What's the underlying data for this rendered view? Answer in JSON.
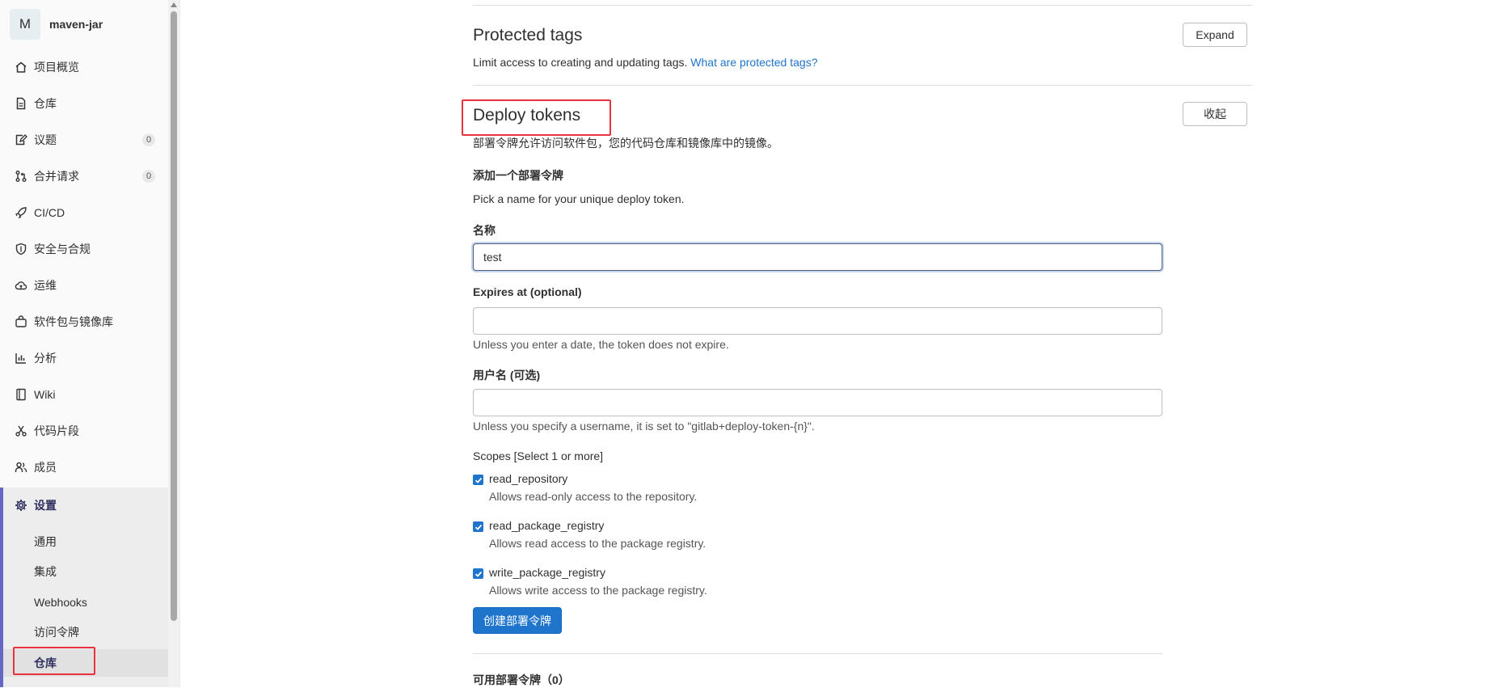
{
  "project": {
    "avatar_letter": "M",
    "name": "maven-jar"
  },
  "sidebar": {
    "items": [
      {
        "label": "项目概览",
        "icon": "home-icon"
      },
      {
        "label": "仓库",
        "icon": "document-icon"
      },
      {
        "label": "议题",
        "icon": "issues-icon",
        "badge": "0"
      },
      {
        "label": "合并请求",
        "icon": "merge-request-icon",
        "badge": "0"
      },
      {
        "label": "CI/CD",
        "icon": "rocket-icon"
      },
      {
        "label": "安全与合规",
        "icon": "shield-icon"
      },
      {
        "label": "运维",
        "icon": "cloud-icon"
      },
      {
        "label": "软件包与镜像库",
        "icon": "package-icon"
      },
      {
        "label": "分析",
        "icon": "chart-icon"
      },
      {
        "label": "Wiki",
        "icon": "book-icon"
      },
      {
        "label": "代码片段",
        "icon": "snippet-icon"
      },
      {
        "label": "成员",
        "icon": "users-icon"
      }
    ],
    "settings": {
      "label": "设置",
      "icon": "gear-icon",
      "sub_items": [
        "通用",
        "集成",
        "Webhooks",
        "访问令牌",
        "仓库"
      ],
      "active_sub_item": "仓库"
    }
  },
  "protected_tags": {
    "title": "Protected tags",
    "description": "Limit access to creating and updating tags.",
    "link_text": "What are protected tags?",
    "button": "Expand"
  },
  "deploy_tokens": {
    "title": "Deploy tokens",
    "button": "收起",
    "description": "部署令牌允许访问软件包，您的代码仓库和镜像库中的镜像。",
    "add_heading": "添加一个部署令牌",
    "add_subtext": "Pick a name for your unique deploy token.",
    "name_label": "名称",
    "name_value": "test",
    "expires_label": "Expires at (optional)",
    "expires_value": "",
    "expires_help": "Unless you enter a date, the token does not expire.",
    "username_label": "用户名 (可选)",
    "username_value": "",
    "username_help": "Unless you specify a username, it is set to \"gitlab+deploy-token-{n}\".",
    "scopes_label": "Scopes [Select 1 or more]",
    "scopes": [
      {
        "name": "read_repository",
        "help": "Allows read-only access to the repository.",
        "checked": true
      },
      {
        "name": "read_package_registry",
        "help": "Allows read access to the package registry.",
        "checked": true
      },
      {
        "name": "write_package_registry",
        "help": "Allows write access to the package registry.",
        "checked": true
      }
    ],
    "create_button": "创建部署令牌",
    "available_heading": "可用部署令牌（0）"
  },
  "colors": {
    "accent": "#1f75cb",
    "highlight_box": "#e8323d",
    "settings_bar": "#6666c4"
  }
}
